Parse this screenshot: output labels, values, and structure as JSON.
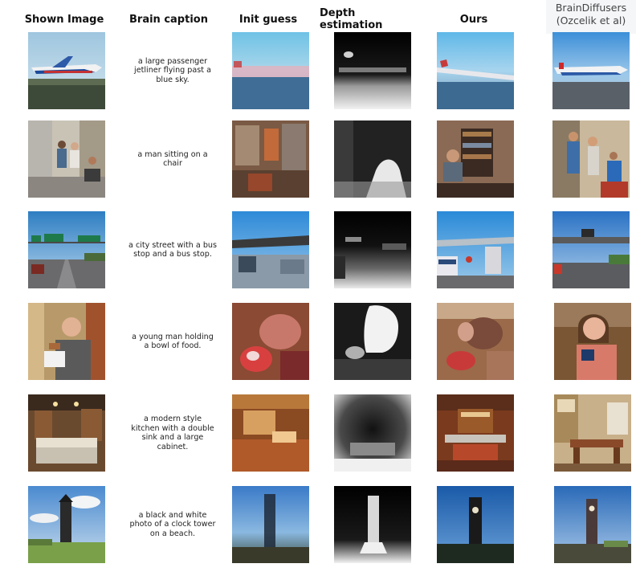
{
  "headers": {
    "shown_image": "Shown Image",
    "brain_caption": "Brain caption",
    "init_guess": "Init guess",
    "depth_estimation": "Depth estimation",
    "ours": "Ours",
    "braindiffusers_line1": "BrainDiffusers",
    "braindiffusers_line2": "(Ozcelik et al)"
  },
  "rows": [
    {
      "caption": "a large passenger jetliner flying past a blue sky.",
      "scene": "airplane"
    },
    {
      "caption": "a man sitting on a chair",
      "scene": "people"
    },
    {
      "caption": "a city street with a bus stop and a bus stop.",
      "scene": "street"
    },
    {
      "caption": "a young man holding a bowl of food.",
      "scene": "person-food"
    },
    {
      "caption": "a modern style kitchen with a double sink and a large cabinet.",
      "scene": "kitchen"
    },
    {
      "caption": "a black and white photo of a clock tower on a beach.",
      "scene": "clock-tower"
    }
  ]
}
